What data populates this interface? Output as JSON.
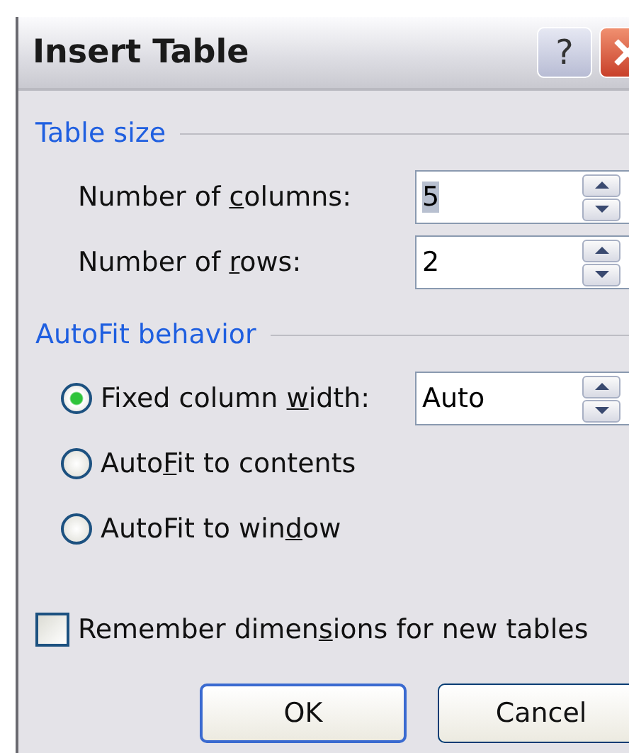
{
  "window": {
    "title": "Insert Table",
    "help_button": "?"
  },
  "groups": [
    {
      "title": "Table size",
      "rows": [
        {
          "kind": "spin",
          "label": {
            "before": "Number of ",
            "key": "c",
            "after": "olumns:"
          },
          "value": "5",
          "value_selected": true
        },
        {
          "kind": "spin",
          "label": {
            "before": "Number of ",
            "key": "r",
            "after": "ows:"
          },
          "value": "2",
          "value_selected": false
        }
      ]
    },
    {
      "title": "AutoFit behavior",
      "rows": [
        {
          "kind": "radio",
          "selected": true,
          "label": {
            "before": "Fixed column ",
            "key": "w",
            "after": "idth:"
          },
          "value": "Auto"
        },
        {
          "kind": "radio",
          "selected": false,
          "label": {
            "before": "Auto",
            "key": "F",
            "after": "it to contents"
          }
        },
        {
          "kind": "radio",
          "selected": false,
          "label": {
            "before": "AutoFit to win",
            "key": "d",
            "after": "ow"
          }
        }
      ]
    }
  ],
  "remember": {
    "checked": false,
    "label": {
      "before": "Remember dimen",
      "key": "s",
      "after": "ions for new tables"
    }
  },
  "buttons": [
    {
      "label": "OK",
      "default": true
    },
    {
      "label": "Cancel",
      "default": false
    }
  ]
}
